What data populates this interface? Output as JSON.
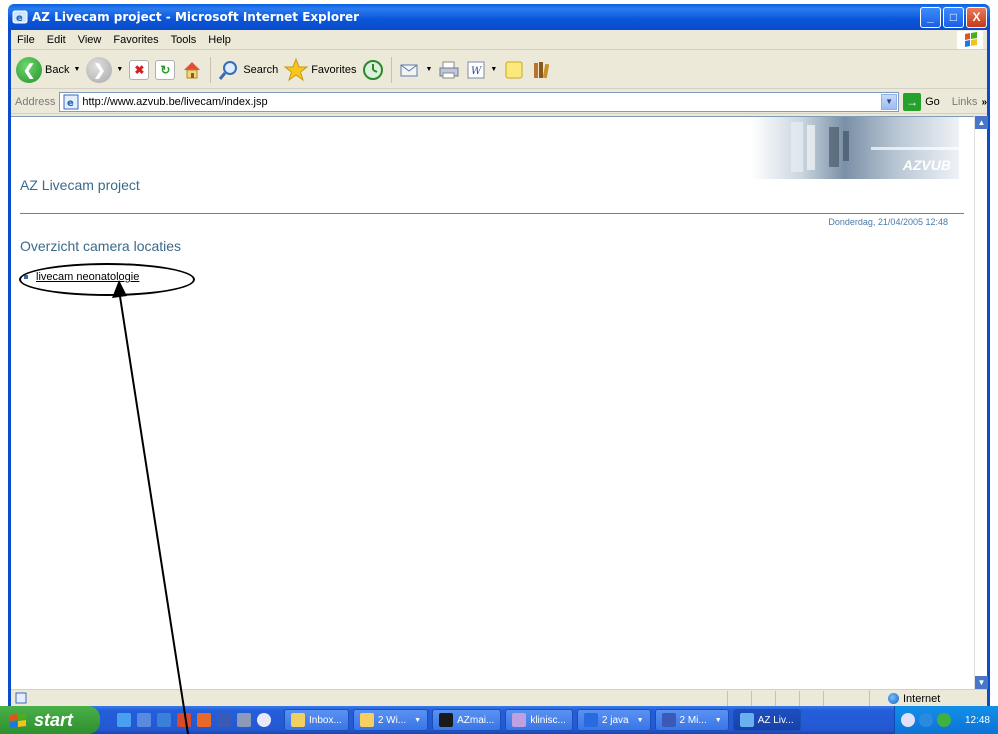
{
  "window": {
    "title": "AZ Livecam project - Microsoft Internet Explorer",
    "minimize_glyph": "_",
    "maximize_glyph": "□",
    "close_glyph": "X"
  },
  "menubar": {
    "items": [
      "File",
      "Edit",
      "View",
      "Favorites",
      "Tools",
      "Help"
    ]
  },
  "toolbar": {
    "back_label": "Back",
    "search_label": "Search",
    "favorites_label": "Favorites"
  },
  "addressbar": {
    "label": "Address",
    "url": "http://www.azvub.be/livecam/index.jsp",
    "go_label": "Go",
    "links_label": "Links"
  },
  "page": {
    "site_title": "AZ Livecam project",
    "banner_logo": "AZVUB",
    "datetime": "Donderdag, 21/04/2005 12:48",
    "section_title": "Overzicht camera locaties",
    "links": [
      "livecam neonatologie"
    ]
  },
  "statusbar": {
    "zone": "Internet"
  },
  "taskbar": {
    "start_label": "start",
    "tasks": [
      "Inbox...",
      "2 Wi...",
      "AZmai...",
      "klinisc...",
      "2 java",
      "2 Mi...",
      "AZ Liv..."
    ],
    "clock": "12:48"
  },
  "colors": {
    "title_blue": "#0a5fe0",
    "heading_blue": "#3a6a8a",
    "start_green": "#3a9e3a",
    "annotation": "#000000"
  }
}
